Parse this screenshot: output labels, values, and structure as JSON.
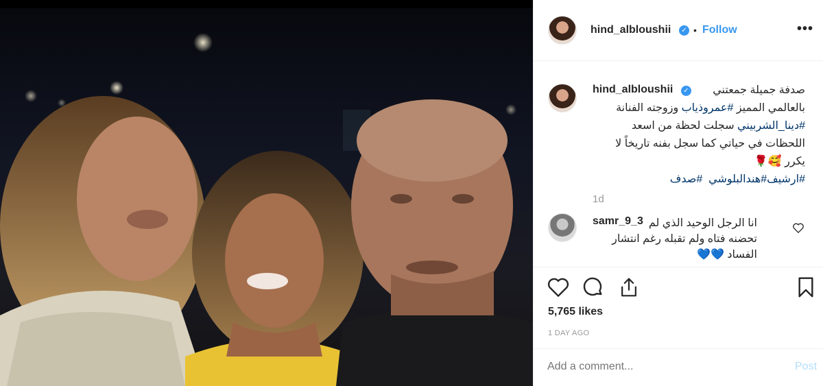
{
  "post": {
    "username": "hind_albloushii",
    "verified_icon": "verified-badge-icon",
    "separator": "•",
    "follow_label": "Follow",
    "more_icon": "more-options-icon",
    "more_label": "•••"
  },
  "caption": {
    "username": "hind_albloushii",
    "line1": "صدفة جميلة جمعتني",
    "line2_text": "بالعالمي المميز ",
    "line2_tag": "#عمروذياب",
    "line2_rest": " وزوجته الفنانة",
    "line3_tag": "#دينا_الشربيني",
    "line3_rest": " سجلت لحظة من اسعد",
    "line4": "اللحظات في حياتي كما سجل بفنه تاريخاً لا",
    "line5": "يكرر",
    "line5_emojis": "🥰🌹",
    "line6_tag1": "#ارشيف",
    "line6_tag2": "#هندالبلوشي",
    "line6_tag3": "#صدف",
    "time_ago": "1d"
  },
  "comment": {
    "username": "samr_9_3",
    "line1": "انا الرجل الوحيد الذي لم",
    "line2": "تحضنه فتاه ولم تقبله رغم انتشار",
    "line3": "الفساد",
    "emojis": "💙💙",
    "heart_icon": "heart-outline-icon"
  },
  "actions": {
    "like_icon": "heart-icon",
    "comment_icon": "comment-icon",
    "share_icon": "share-icon",
    "save_icon": "bookmark-icon",
    "likes": "5,765 likes",
    "date": "1 DAY AGO",
    "comment_placeholder": "Add a comment...",
    "post_label": "Post"
  },
  "colors": {
    "accent": "#3897f0",
    "hashtag": "#003569",
    "muted": "#999999",
    "post_disabled": "#b2dffc"
  }
}
